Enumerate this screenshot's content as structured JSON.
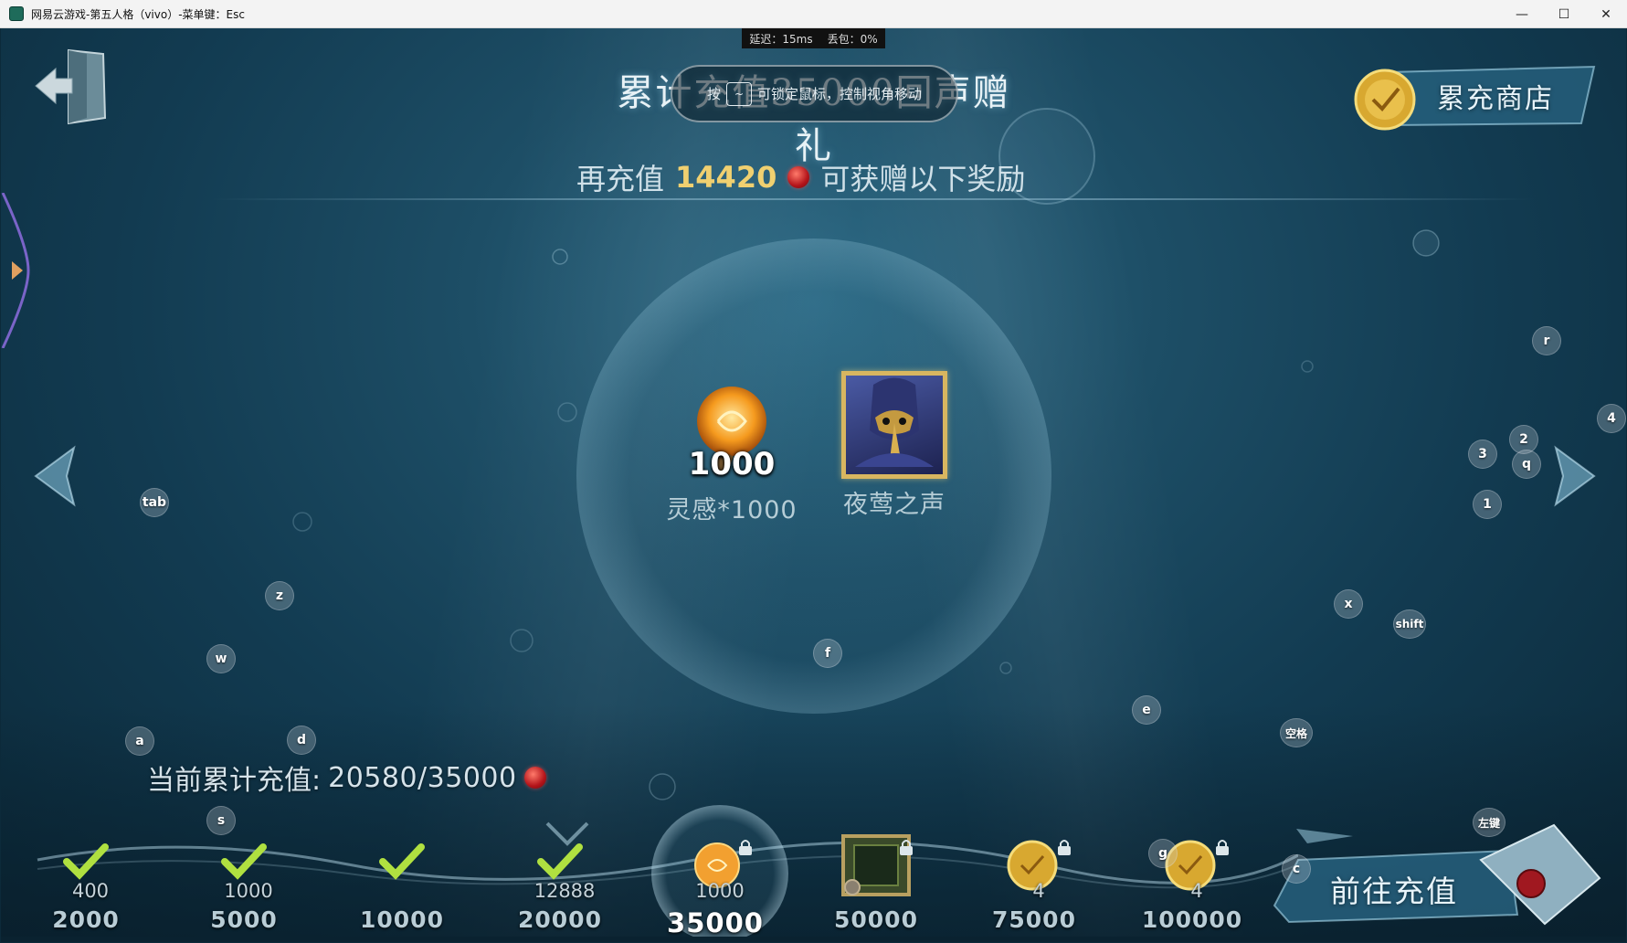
{
  "window": {
    "title": "网易云游戏-第五人格（vivo）-菜单键：Esc",
    "controls": {
      "minimize": "—",
      "maximize": "☐",
      "close": "✕"
    }
  },
  "netstats": {
    "latency": "延迟：15ms",
    "loss": "丢包：0%"
  },
  "header": {
    "title": "累计充值35000回声赠礼",
    "shop_label": "累充商店"
  },
  "hint": {
    "prefix": "按",
    "key": "~",
    "text": "可锁定鼠标，控制视角移动"
  },
  "recharge": {
    "prefix": "再充值",
    "amount": "14420",
    "suffix": "可获赠以下奖励"
  },
  "rewards": [
    {
      "count": "1000",
      "name": "灵感*1000"
    },
    {
      "name": "夜莺之声"
    }
  ],
  "progress": {
    "label": "当前累计充值:",
    "value": "20580/35000",
    "current": 20580,
    "target": 35000
  },
  "tiers": [
    {
      "qty": "400",
      "threshold": "2000",
      "state": "claimed"
    },
    {
      "qty": "1000",
      "threshold": "5000",
      "state": "claimed"
    },
    {
      "qty": "",
      "threshold": "10000",
      "state": "claimed"
    },
    {
      "qty": "12888",
      "threshold": "20000",
      "state": "claimed"
    },
    {
      "qty": "1000",
      "threshold": "35000",
      "state": "current"
    },
    {
      "qty": "",
      "threshold": "50000",
      "state": "locked"
    },
    {
      "qty": "4",
      "threshold": "75000",
      "state": "locked"
    },
    {
      "qty": "4",
      "threshold": "100000",
      "state": "locked"
    }
  ],
  "go_recharge_label": "前往充值",
  "keyhints": {
    "tab": "tab",
    "z": "z",
    "w": "w",
    "a": "a",
    "d": "d",
    "s": "s",
    "f": "f",
    "e": "e",
    "x": "x",
    "shift": "shift",
    "space": "空格",
    "r": "r",
    "four": "4",
    "two": "2",
    "three": "3",
    "q": "q",
    "one": "1",
    "g": "g",
    "c": "c",
    "left_click": "左键"
  },
  "colors": {
    "gold": "#f0d070",
    "gem_red": "#b4141a",
    "water": "#1d4e66"
  }
}
